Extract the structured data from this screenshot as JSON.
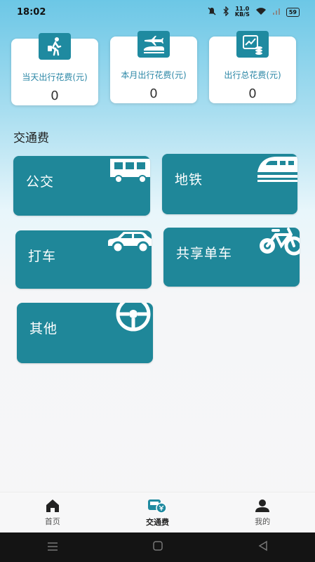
{
  "status_bar": {
    "time": "18:02",
    "network_speed_value": "11.0",
    "network_speed_unit": "KB/S",
    "battery": "59"
  },
  "stats": [
    {
      "label": "当天出行花费(元)",
      "value": "0",
      "icon": "walking-traveler-icon"
    },
    {
      "label": "本月出行花费(元)",
      "value": "0",
      "icon": "plane-train-icon"
    },
    {
      "label": "出行总花费(元)",
      "value": "0",
      "icon": "chart-coins-icon"
    }
  ],
  "section_title": "交通费",
  "categories": [
    {
      "label": "公交",
      "icon": "bus-icon"
    },
    {
      "label": "地铁",
      "icon": "metro-train-icon"
    },
    {
      "label": "打车",
      "icon": "car-icon"
    },
    {
      "label": "共享单车",
      "icon": "bicycle-icon"
    },
    {
      "label": "其他",
      "icon": "steering-wheel-icon"
    }
  ],
  "bottom_nav": [
    {
      "label": "首页",
      "icon": "home-icon",
      "active": false
    },
    {
      "label": "交通费",
      "icon": "transport-fee-icon",
      "active": true
    },
    {
      "label": "我的",
      "icon": "user-icon",
      "active": false
    }
  ],
  "colors": {
    "tile": "#1f8799",
    "accent_text": "#2b87a6",
    "icon_bg": "#1f8aa0"
  }
}
